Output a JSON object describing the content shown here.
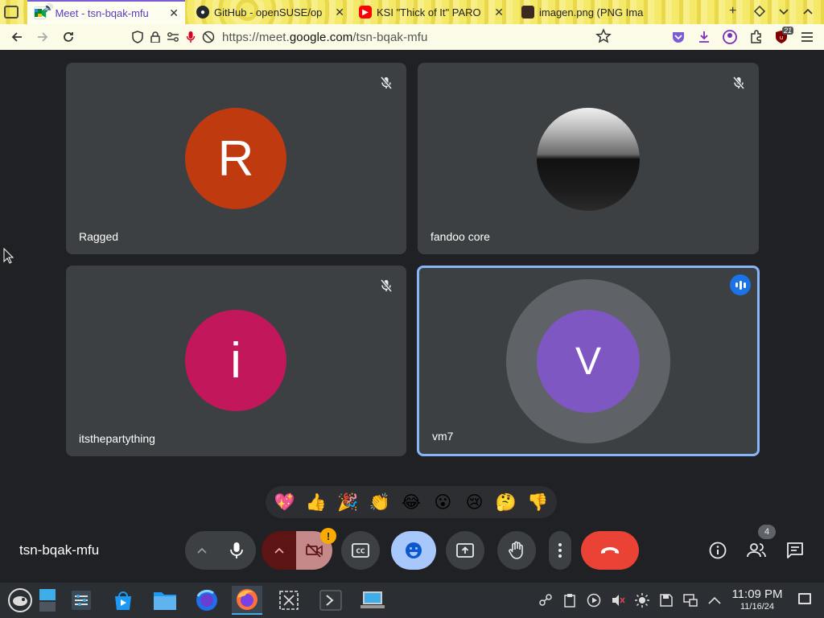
{
  "browser": {
    "tabs": [
      {
        "title": "Meet - tsn-bqak-mfu",
        "active": true
      },
      {
        "title": "GitHub - openSUSE/op",
        "active": false
      },
      {
        "title": "KSI \"Thick of It\" PARO",
        "active": false
      },
      {
        "title": "imagen.png (PNG Ima",
        "active": false
      }
    ],
    "url": {
      "prefix": "https://meet.",
      "domain": "google.com",
      "path": "/tsn-bqak-mfu"
    },
    "extension_badge": "21"
  },
  "participants": [
    {
      "name": "Ragged",
      "initial": "R",
      "color": "#c03a0f",
      "muted": true
    },
    {
      "name": "fandoo core",
      "initial": "",
      "color": "#1f1f1f",
      "muted": true
    },
    {
      "name": "itsthepartything",
      "initial": "i",
      "color": "#c2185b",
      "muted": true
    },
    {
      "name": "vm7",
      "initial": "V",
      "color": "#7e57c2",
      "muted": false,
      "speaking": true
    }
  ],
  "reactions": [
    "💖",
    "👍",
    "🎉",
    "👏",
    "😂",
    "😮",
    "😢",
    "🤔",
    "👎"
  ],
  "meeting": {
    "code": "tsn-bqak-mfu",
    "people_count": "4"
  },
  "colors": {
    "background": "#202124",
    "tile": "#3c4043",
    "active_border": "#8ab4f8",
    "leave": "#ea4335",
    "reaction_active": "#a8c7fa"
  },
  "taskbar": {
    "time": "11:09 PM",
    "date": "11/16/24"
  }
}
